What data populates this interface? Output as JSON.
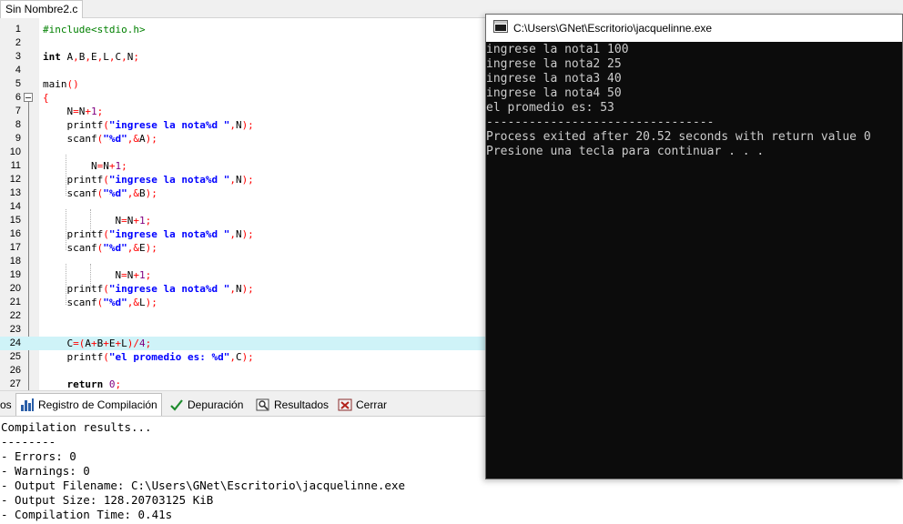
{
  "editor": {
    "file_tab": "Sin Nombre2.c",
    "highlighted_line": 24,
    "lines": [
      {
        "n": "1",
        "parts": [
          {
            "t": "#include<stdio.h>",
            "c": "pp"
          }
        ]
      },
      {
        "n": "2",
        "parts": []
      },
      {
        "n": "3",
        "parts": [
          {
            "t": "int",
            "c": "kw"
          },
          {
            "t": " A",
            "c": ""
          },
          {
            "t": ",",
            "c": "sym"
          },
          {
            "t": "B",
            "c": ""
          },
          {
            "t": ",",
            "c": "sym"
          },
          {
            "t": "E",
            "c": ""
          },
          {
            "t": ",",
            "c": "sym"
          },
          {
            "t": "L",
            "c": ""
          },
          {
            "t": ",",
            "c": "sym"
          },
          {
            "t": "C",
            "c": ""
          },
          {
            "t": ",",
            "c": "sym"
          },
          {
            "t": "N",
            "c": ""
          },
          {
            "t": ";",
            "c": "sym"
          }
        ]
      },
      {
        "n": "4",
        "parts": []
      },
      {
        "n": "5",
        "parts": [
          {
            "t": "main",
            "c": ""
          },
          {
            "t": "()",
            "c": "sym"
          }
        ]
      },
      {
        "n": "6",
        "parts": [
          {
            "t": "{",
            "c": "sym"
          }
        ]
      },
      {
        "n": "7",
        "parts": [
          {
            "t": "    N",
            "c": ""
          },
          {
            "t": "=",
            "c": "sym"
          },
          {
            "t": "N",
            "c": ""
          },
          {
            "t": "+",
            "c": "sym"
          },
          {
            "t": "1",
            "c": "num"
          },
          {
            "t": ";",
            "c": "sym"
          }
        ]
      },
      {
        "n": "8",
        "parts": [
          {
            "t": "    printf",
            "c": ""
          },
          {
            "t": "(",
            "c": "sym"
          },
          {
            "t": "\"ingrese la nota%d \"",
            "c": "str"
          },
          {
            "t": ",",
            "c": "sym"
          },
          {
            "t": "N",
            "c": ""
          },
          {
            "t": ");",
            "c": "sym"
          }
        ]
      },
      {
        "n": "9",
        "parts": [
          {
            "t": "    scanf",
            "c": ""
          },
          {
            "t": "(",
            "c": "sym"
          },
          {
            "t": "\"%d\"",
            "c": "str"
          },
          {
            "t": ",&",
            "c": "sym"
          },
          {
            "t": "A",
            "c": ""
          },
          {
            "t": ");",
            "c": "sym"
          }
        ]
      },
      {
        "n": "10",
        "parts": []
      },
      {
        "n": "11",
        "parts": [
          {
            "t": "        N",
            "c": ""
          },
          {
            "t": "=",
            "c": "sym"
          },
          {
            "t": "N",
            "c": ""
          },
          {
            "t": "+",
            "c": "sym"
          },
          {
            "t": "1",
            "c": "num"
          },
          {
            "t": ";",
            "c": "sym"
          }
        ]
      },
      {
        "n": "12",
        "parts": [
          {
            "t": "    printf",
            "c": ""
          },
          {
            "t": "(",
            "c": "sym"
          },
          {
            "t": "\"ingrese la nota%d \"",
            "c": "str"
          },
          {
            "t": ",",
            "c": "sym"
          },
          {
            "t": "N",
            "c": ""
          },
          {
            "t": ");",
            "c": "sym"
          }
        ]
      },
      {
        "n": "13",
        "parts": [
          {
            "t": "    scanf",
            "c": ""
          },
          {
            "t": "(",
            "c": "sym"
          },
          {
            "t": "\"%d\"",
            "c": "str"
          },
          {
            "t": ",&",
            "c": "sym"
          },
          {
            "t": "B",
            "c": ""
          },
          {
            "t": ");",
            "c": "sym"
          }
        ]
      },
      {
        "n": "14",
        "parts": []
      },
      {
        "n": "15",
        "parts": [
          {
            "t": "            N",
            "c": ""
          },
          {
            "t": "=",
            "c": "sym"
          },
          {
            "t": "N",
            "c": ""
          },
          {
            "t": "+",
            "c": "sym"
          },
          {
            "t": "1",
            "c": "num"
          },
          {
            "t": ";",
            "c": "sym"
          }
        ]
      },
      {
        "n": "16",
        "parts": [
          {
            "t": "    printf",
            "c": ""
          },
          {
            "t": "(",
            "c": "sym"
          },
          {
            "t": "\"ingrese la nota%d \"",
            "c": "str"
          },
          {
            "t": ",",
            "c": "sym"
          },
          {
            "t": "N",
            "c": ""
          },
          {
            "t": ");",
            "c": "sym"
          }
        ]
      },
      {
        "n": "17",
        "parts": [
          {
            "t": "    scanf",
            "c": ""
          },
          {
            "t": "(",
            "c": "sym"
          },
          {
            "t": "\"%d\"",
            "c": "str"
          },
          {
            "t": ",&",
            "c": "sym"
          },
          {
            "t": "E",
            "c": ""
          },
          {
            "t": ");",
            "c": "sym"
          }
        ]
      },
      {
        "n": "18",
        "parts": []
      },
      {
        "n": "19",
        "parts": [
          {
            "t": "            N",
            "c": ""
          },
          {
            "t": "=",
            "c": "sym"
          },
          {
            "t": "N",
            "c": ""
          },
          {
            "t": "+",
            "c": "sym"
          },
          {
            "t": "1",
            "c": "num"
          },
          {
            "t": ";",
            "c": "sym"
          }
        ]
      },
      {
        "n": "20",
        "parts": [
          {
            "t": "    printf",
            "c": ""
          },
          {
            "t": "(",
            "c": "sym"
          },
          {
            "t": "\"ingrese la nota%d \"",
            "c": "str"
          },
          {
            "t": ",",
            "c": "sym"
          },
          {
            "t": "N",
            "c": ""
          },
          {
            "t": ");",
            "c": "sym"
          }
        ]
      },
      {
        "n": "21",
        "parts": [
          {
            "t": "    scanf",
            "c": ""
          },
          {
            "t": "(",
            "c": "sym"
          },
          {
            "t": "\"%d\"",
            "c": "str"
          },
          {
            "t": ",&",
            "c": "sym"
          },
          {
            "t": "L",
            "c": ""
          },
          {
            "t": ");",
            "c": "sym"
          }
        ]
      },
      {
        "n": "22",
        "parts": []
      },
      {
        "n": "23",
        "parts": []
      },
      {
        "n": "24",
        "parts": [
          {
            "t": "    C",
            "c": ""
          },
          {
            "t": "=(",
            "c": "sym"
          },
          {
            "t": "A",
            "c": ""
          },
          {
            "t": "+",
            "c": "sym"
          },
          {
            "t": "B",
            "c": ""
          },
          {
            "t": "+",
            "c": "sym"
          },
          {
            "t": "E",
            "c": ""
          },
          {
            "t": "+",
            "c": "sym"
          },
          {
            "t": "L",
            "c": ""
          },
          {
            "t": ")/",
            "c": "sym"
          },
          {
            "t": "4",
            "c": "num"
          },
          {
            "t": ";",
            "c": "sym"
          }
        ]
      },
      {
        "n": "25",
        "parts": [
          {
            "t": "    printf",
            "c": ""
          },
          {
            "t": "(",
            "c": "sym"
          },
          {
            "t": "\"el promedio es: %d\"",
            "c": "str"
          },
          {
            "t": ",",
            "c": "sym"
          },
          {
            "t": "C",
            "c": ""
          },
          {
            "t": ");",
            "c": "sym"
          }
        ]
      },
      {
        "n": "26",
        "parts": []
      },
      {
        "n": "27",
        "parts": [
          {
            "t": "    return",
            "c": "kw"
          },
          {
            "t": " ",
            "c": ""
          },
          {
            "t": "0",
            "c": "num"
          },
          {
            "t": ";",
            "c": "sym"
          }
        ]
      }
    ]
  },
  "bottom_tabs": {
    "partial": "os",
    "compile_log": "Registro de Compilación",
    "debug": "Depuración",
    "results": "Resultados",
    "close": "Cerrar"
  },
  "compile_log": [
    "Compilation results...",
    "--------",
    "- Errors: 0",
    "- Warnings: 0",
    "- Output Filename: C:\\Users\\GNet\\Escritorio\\jacquelinne.exe",
    "- Output Size: 128.20703125 KiB",
    "- Compilation Time: 0.41s"
  ],
  "console": {
    "title": "C:\\Users\\GNet\\Escritorio\\jacquelinne.exe",
    "lines": [
      "ingrese la nota1 100",
      "ingrese la nota2 25",
      "ingrese la nota3 40",
      "ingrese la nota4 50",
      "el promedio es: 53",
      "--------------------------------",
      "Process exited after 20.52 seconds with return value 0",
      "Presione una tecla para continuar . . ."
    ]
  },
  "colors": {
    "console_bg": "#0c0c0c",
    "console_text": "#cccccc",
    "highlight_line": "#cff3f8",
    "string": "#0000ff",
    "symbol": "#ff0000",
    "preprocessor": "#008000",
    "number": "#800080"
  },
  "icons": [
    "compile-log-icon",
    "debug-icon",
    "results-icon",
    "close-icon",
    "console-app-icon"
  ]
}
